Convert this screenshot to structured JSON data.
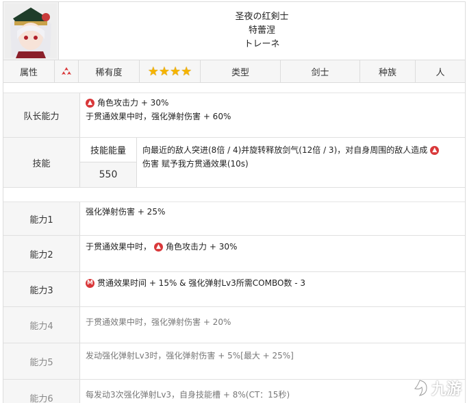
{
  "header": {
    "name_zh": "圣夜の红剣士",
    "name_jp": "特蕾涅",
    "name_kana": "トレーネ"
  },
  "attributes": {
    "element_label": "属性",
    "rarity_label": "稀有度",
    "rarity_stars": 4,
    "type_label": "类型",
    "type_value": "剑士",
    "race_label": "种族",
    "race_value": "人",
    "accent_color": "#d9383a",
    "star_color": "#f5b400"
  },
  "leader": {
    "label": "队长能力",
    "line1": "角色攻击力 + 30%",
    "line2": "于贯通效果中时，强化弹射伤害 + 60%"
  },
  "skill": {
    "label": "技能",
    "energy_label": "技能能量",
    "energy_value": "550",
    "desc1": "向最近的敌人突进(8倍 / 4)并旋转释放剑气(12倍 / 3)，对自身周围的敌人造成",
    "desc2": "伤害 赋予我方贯通效果(10s)"
  },
  "abilities": [
    {
      "label": "能力1",
      "text": "强化弹射伤害 + 25%"
    },
    {
      "label": "能力2",
      "pre": "于贯通效果中时，",
      "text": "角色攻击力 + 30%"
    },
    {
      "label": "能力3",
      "text": "贯通效果时间 + 15% & 强化弹射Lv3所需COMBO数 - 3"
    },
    {
      "label": "能力4",
      "text": "于贯通效果中时，强化弹射伤害 + 20%"
    },
    {
      "label": "能力5",
      "text": "发动强化弹射Lv3时，强化弹射伤害 + 5%[最大 + 25%]"
    },
    {
      "label": "能力6",
      "text": "每发动3次强化弹射Lv3，自身技能槽 + 8%(CT：15秒)"
    }
  ],
  "watermark": {
    "text": "九游"
  }
}
